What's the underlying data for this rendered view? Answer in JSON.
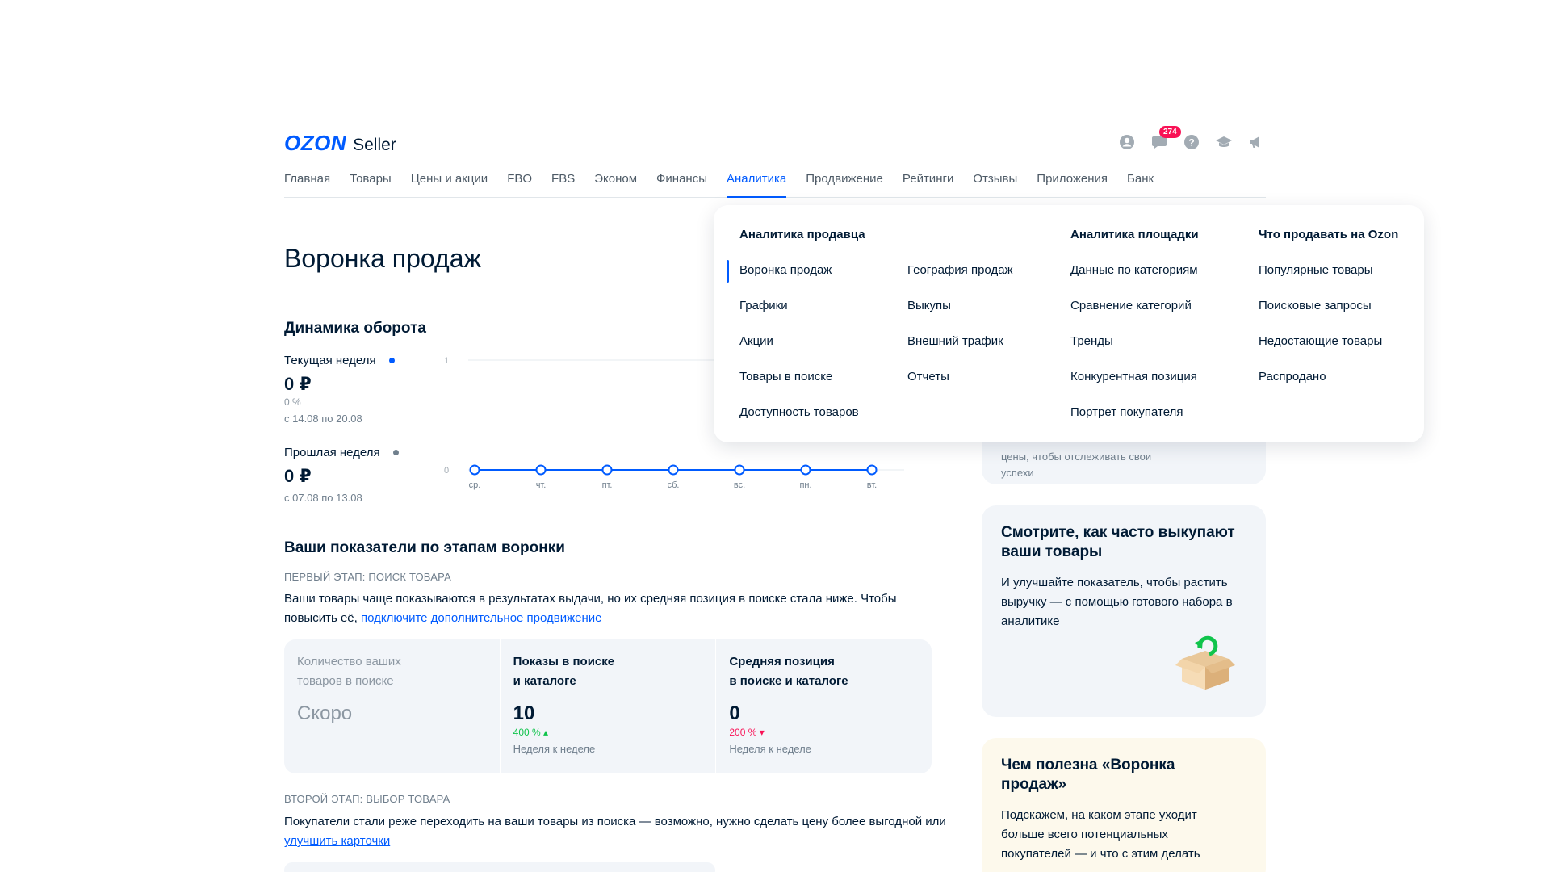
{
  "header": {
    "logo_text": "OZON",
    "logo_suffix": "Seller",
    "notifications_count": "274",
    "brand_color": "#005bff",
    "icons": [
      "profile-icon",
      "chat-icon",
      "help-icon",
      "education-icon",
      "announcement-icon"
    ]
  },
  "nav": {
    "items": [
      "Главная",
      "Товары",
      "Цены и акции",
      "FBO",
      "FBS",
      "Эконом",
      "Финансы",
      "Аналитика",
      "Продвижение",
      "Рейтинги",
      "Отзывы",
      "Приложения",
      "Банк"
    ],
    "active": "Аналитика"
  },
  "page": {
    "title": "Воронка продаж"
  },
  "dynamics": {
    "title": "Динамика оборота",
    "current": {
      "label": "Текущая неделя",
      "value": "0 ₽",
      "pct": "0 %",
      "range": "с 14.08 по 20.08",
      "color": "#005bff"
    },
    "previous": {
      "label": "Прошлая неделя",
      "value": "0 ₽",
      "range": "с 07.08 по 13.08",
      "color": "#707f8d"
    }
  },
  "chart_data": {
    "type": "line",
    "title": "",
    "x": [
      "ср.",
      "чт.",
      "пт.",
      "сб.",
      "вс.",
      "пн.",
      "вт."
    ],
    "series": [
      {
        "name": "Текущая неделя",
        "values": [
          0,
          0,
          0,
          0,
          0,
          0,
          0
        ]
      }
    ],
    "ytick_labels": [
      "1",
      "0"
    ],
    "ylim": [
      0,
      1
    ],
    "grid": true,
    "line_color": "#005bff"
  },
  "funnel": {
    "title": "Ваши показатели по этапам воронки",
    "stage1": {
      "label": "Первый этап: поиск товара",
      "text": "Ваши товары чаще показываются в результатах выдачи, но их средняя позиция в поиске стала ниже. Чтобы повысить её, ",
      "link": "подключите дополнительное продвижение"
    },
    "metrics": [
      {
        "title_line1": "Количество ваших",
        "title_line2": "товаров в поиске",
        "value": "Скоро"
      },
      {
        "title_line1": "Показы в поиске",
        "title_line2": "и каталоге",
        "value": "10",
        "delta": "400 % ▴",
        "sub": "Неделя к неделе"
      },
      {
        "title_line1": "Средняя позиция",
        "title_line2": "в поиске и каталоге",
        "value": "0",
        "delta": "200 % ▾",
        "sub": "Неделя к неделе"
      }
    ],
    "stage2": {
      "label": "Второй этап: выбор товара",
      "text": "Покупатели стали реже переходить на ваши товары из поиска — возможно, нужно сделать цену более выгодной или ",
      "link": "улучшить карточки"
    }
  },
  "sidebar": {
    "partial_card_line1": "цены, чтобы отслеживать свои",
    "partial_card_line2": "успехи",
    "card2": {
      "title": "Смотрите, как часто выкупают ваши товары",
      "text": "И улучшайте показатель, чтобы растить выручку — с помощью готового набора в аналитике"
    },
    "card3": {
      "title": "Чем полезна «Воронка продаж»",
      "text": "Подскажем, на каком этапе уходит больше всего потенциальных покупателей — и что с этим делать"
    }
  },
  "dropdown": {
    "seller_title": "Аналитика продавца",
    "seller_col1": [
      "Воронка продаж",
      "Графики",
      "Акции",
      "Товары в поиске",
      "Доступность товаров"
    ],
    "seller_col2": [
      "География продаж",
      "Выкупы",
      "Внешний трафик",
      "Отчеты"
    ],
    "platform_title": "Аналитика площадки",
    "platform_items": [
      "Данные по категориям",
      "Сравнение категорий",
      "Тренды",
      "Конкурентная позиция",
      "Портрет покупателя"
    ],
    "what_title": "Что продавать на Ozon",
    "what_items": [
      "Популярные товары",
      "Поисковые запросы",
      "Недостающие товары",
      "Распродано"
    ]
  }
}
